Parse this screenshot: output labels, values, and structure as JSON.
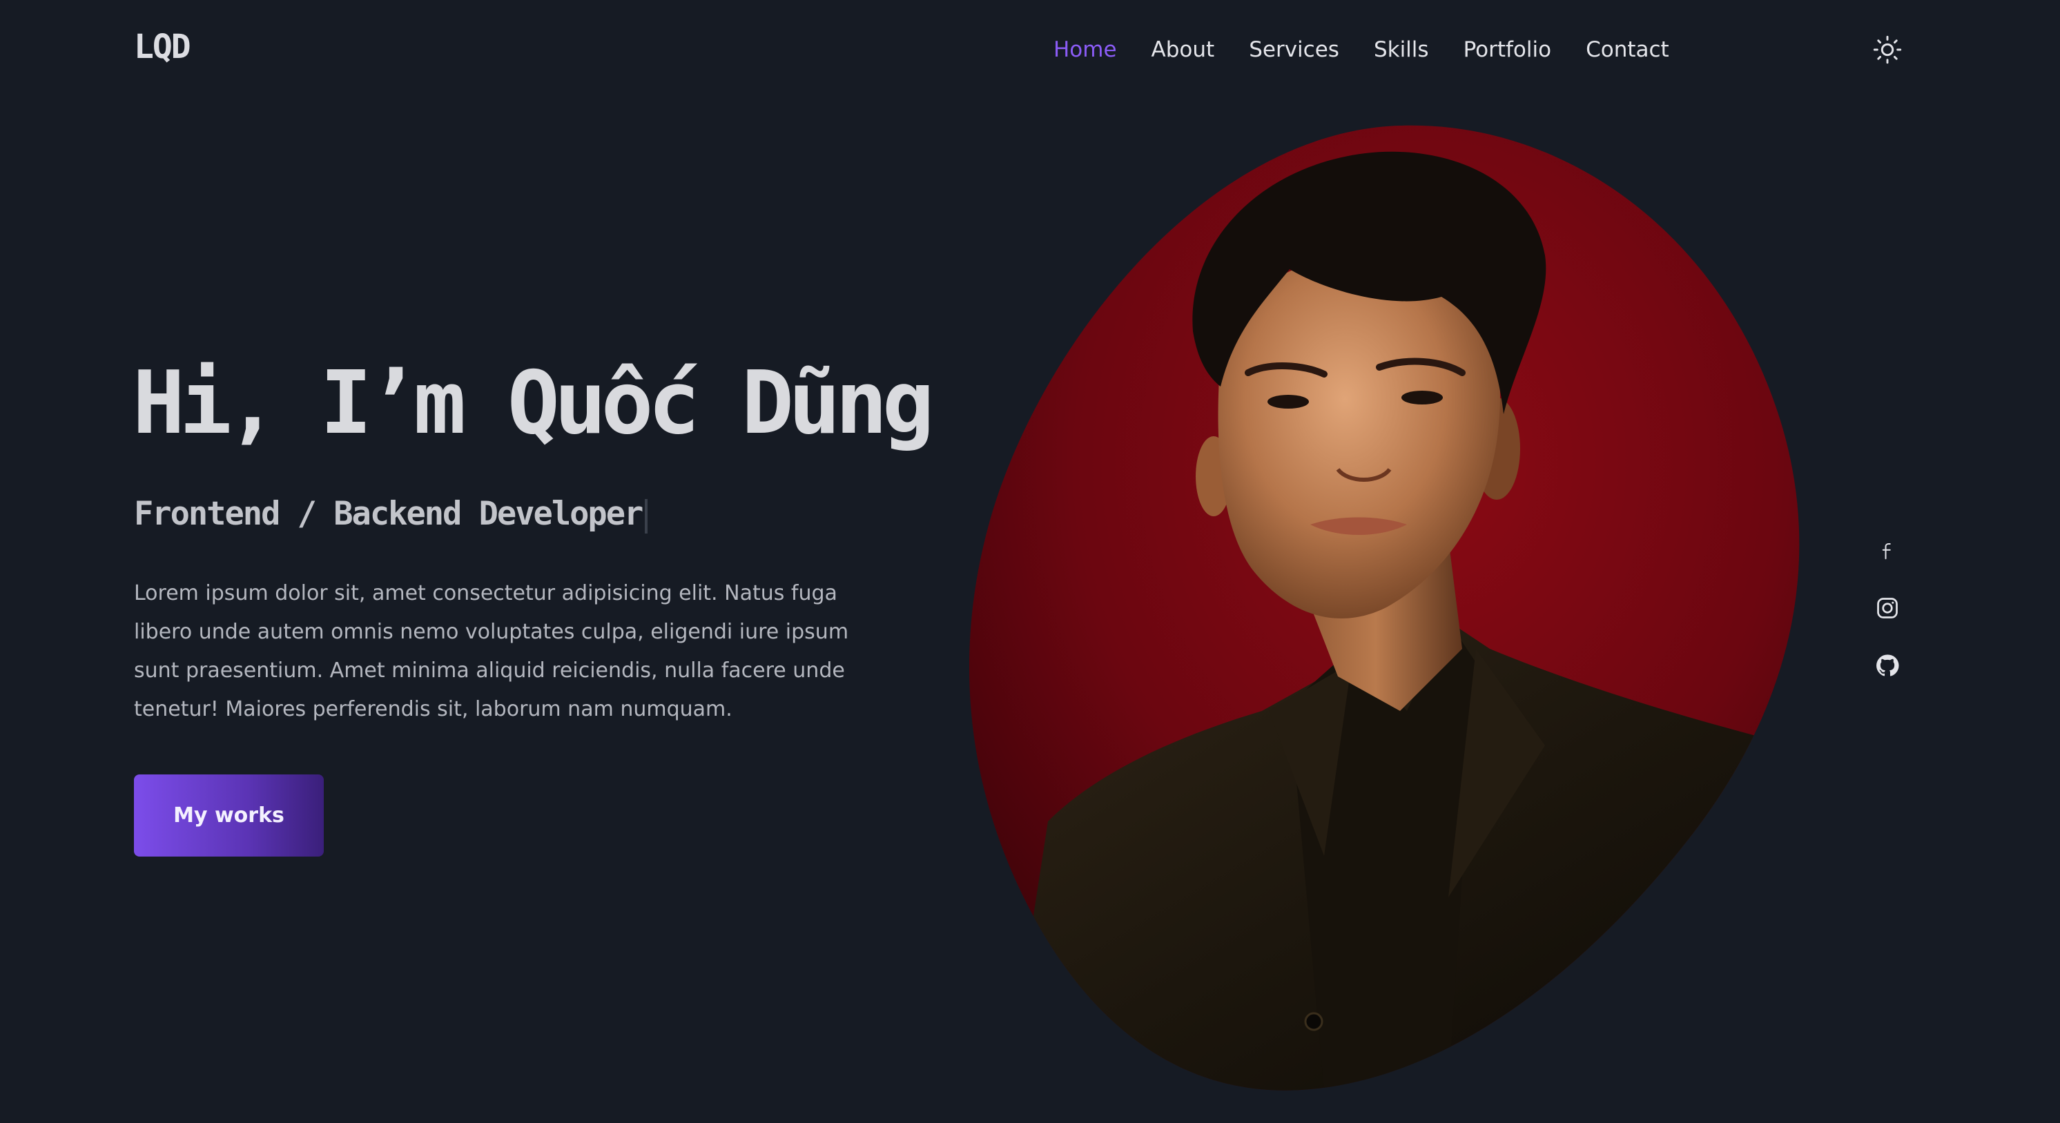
{
  "brand": {
    "logo_text": "LQD"
  },
  "nav": {
    "items": [
      {
        "label": "Home",
        "active": true
      },
      {
        "label": "About",
        "active": false
      },
      {
        "label": "Services",
        "active": false
      },
      {
        "label": "Skills",
        "active": false
      },
      {
        "label": "Portfolio",
        "active": false
      },
      {
        "label": "Contact",
        "active": false
      }
    ],
    "theme_toggle_icon": "sun-icon"
  },
  "hero": {
    "title": "Hi, I’m Quốc Dũng",
    "subtitle": "Frontend / Backend Developer",
    "description": "Lorem ipsum dolor sit, amet consectetur adipisicing elit. Natus fuga libero unde autem omnis nemo voluptates culpa, eligendi iure ipsum sunt praesentium. Amet minima aliquid reiciendis, nulla facere unde tenetur! Maiores perferendis sit, laborum nam numquam.",
    "cta_label": "My works",
    "portrait_icon": "profile-photo"
  },
  "social": [
    {
      "icon": "facebook-icon"
    },
    {
      "icon": "instagram-icon"
    },
    {
      "icon": "github-icon"
    }
  ],
  "colors": {
    "background": "#161b24",
    "accent": "#8b5cf6",
    "text_primary": "#d9dade",
    "portrait_bg": "#6e0710"
  }
}
